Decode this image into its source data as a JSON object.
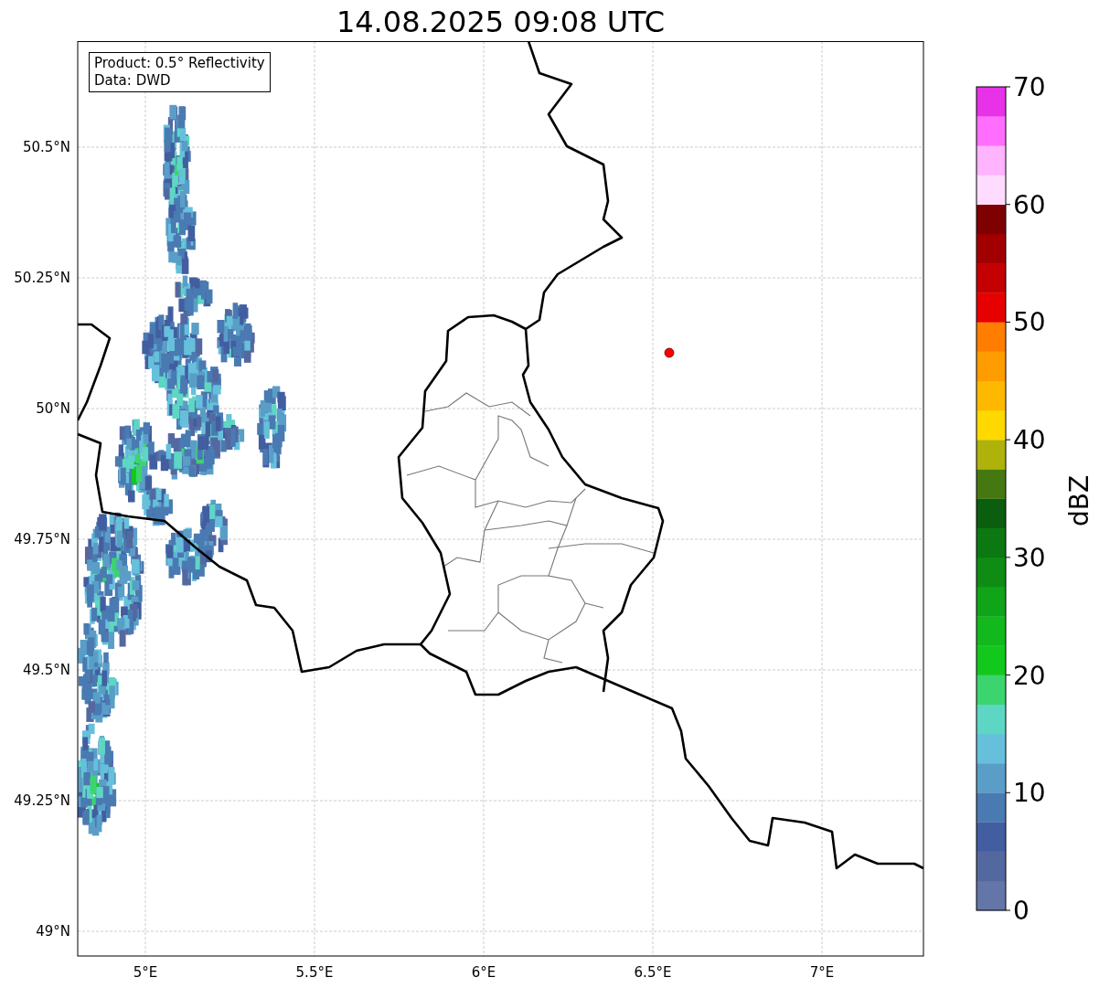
{
  "title": "14.08.2025 09:08 UTC",
  "info_box": {
    "lines": [
      "Product: 0.5° Reflectivity",
      "Data: DWD"
    ]
  },
  "lat_ticks": [
    "50.5°N",
    "50.25°N",
    "50°N",
    "49.75°N",
    "49.5°N",
    "49.25°N",
    "49°N"
  ],
  "lon_ticks": [
    "5°E",
    "5.5°E",
    "6°E",
    "6.5°E",
    "7°E"
  ],
  "colorbar": {
    "label": "dBZ",
    "ticks": [
      "70",
      "60",
      "50",
      "40",
      "30",
      "20",
      "10",
      "0"
    ],
    "bands": [
      {
        "color": "#6475a8"
      },
      {
        "color": "#5468a0"
      },
      {
        "color": "#425ea0"
      },
      {
        "color": "#4a7ab2"
      },
      {
        "color": "#5a9ec8"
      },
      {
        "color": "#66c0dc"
      },
      {
        "color": "#5ed6c4"
      },
      {
        "color": "#3cd46e"
      },
      {
        "color": "#12c81c"
      },
      {
        "color": "#12b81c"
      },
      {
        "color": "#10a418"
      },
      {
        "color": "#0e8c14"
      },
      {
        "color": "#0c7812"
      },
      {
        "color": "#0a5e0e"
      },
      {
        "color": "#467812"
      },
      {
        "color": "#aeb20a"
      },
      {
        "color": "#ffd800"
      },
      {
        "color": "#ffb800"
      },
      {
        "color": "#ff9c00"
      },
      {
        "color": "#ff7e00"
      },
      {
        "color": "#e60000"
      },
      {
        "color": "#c40000"
      },
      {
        "color": "#a20000"
      },
      {
        "color": "#7e0000"
      },
      {
        "color": "#ffdcff"
      },
      {
        "color": "#ffb4ff"
      },
      {
        "color": "#ff6eff"
      },
      {
        "color": "#e832e8"
      }
    ]
  }
}
